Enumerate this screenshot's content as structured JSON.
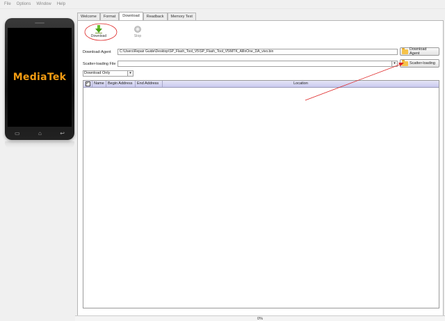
{
  "menubar": {
    "items": [
      "File",
      "Options",
      "Window",
      "Help"
    ]
  },
  "phone": {
    "brand": "MediaTek"
  },
  "tabs": [
    {
      "label": "Welcome",
      "active": false
    },
    {
      "label": "Format",
      "active": false
    },
    {
      "label": "Download",
      "active": true
    },
    {
      "label": "Readback",
      "active": false
    },
    {
      "label": "Memory Test",
      "active": false
    }
  ],
  "toolbar": {
    "download_label": "Download",
    "stop_label": "Stop"
  },
  "form": {
    "agent_label": "Download-Agent",
    "agent_value": "C:\\Users\\Repair Guide\\Desktop\\SP_Flash_Tool_V5\\SP_Flash_Tool_V5\\MTK_AllInOne_DA_vivo.bin",
    "agent_button": "Download Agent",
    "scatter_label": "Scatter-loading File",
    "scatter_value": "",
    "scatter_button": "Scatter-loading",
    "mode_value": "Download Only"
  },
  "table": {
    "columns": [
      "",
      "Name",
      "Begin Address",
      "End Address",
      "Location"
    ]
  },
  "status": {
    "progress_text": "0%",
    "progress": 0
  },
  "colors": {
    "accent_red": "#dd2222",
    "header": "#c9c9ef",
    "brand": "#f39c12"
  },
  "icons": {
    "download": "green-down-arrow-icon",
    "stop": "stop-circle-icon",
    "folder": "folder-icon"
  }
}
